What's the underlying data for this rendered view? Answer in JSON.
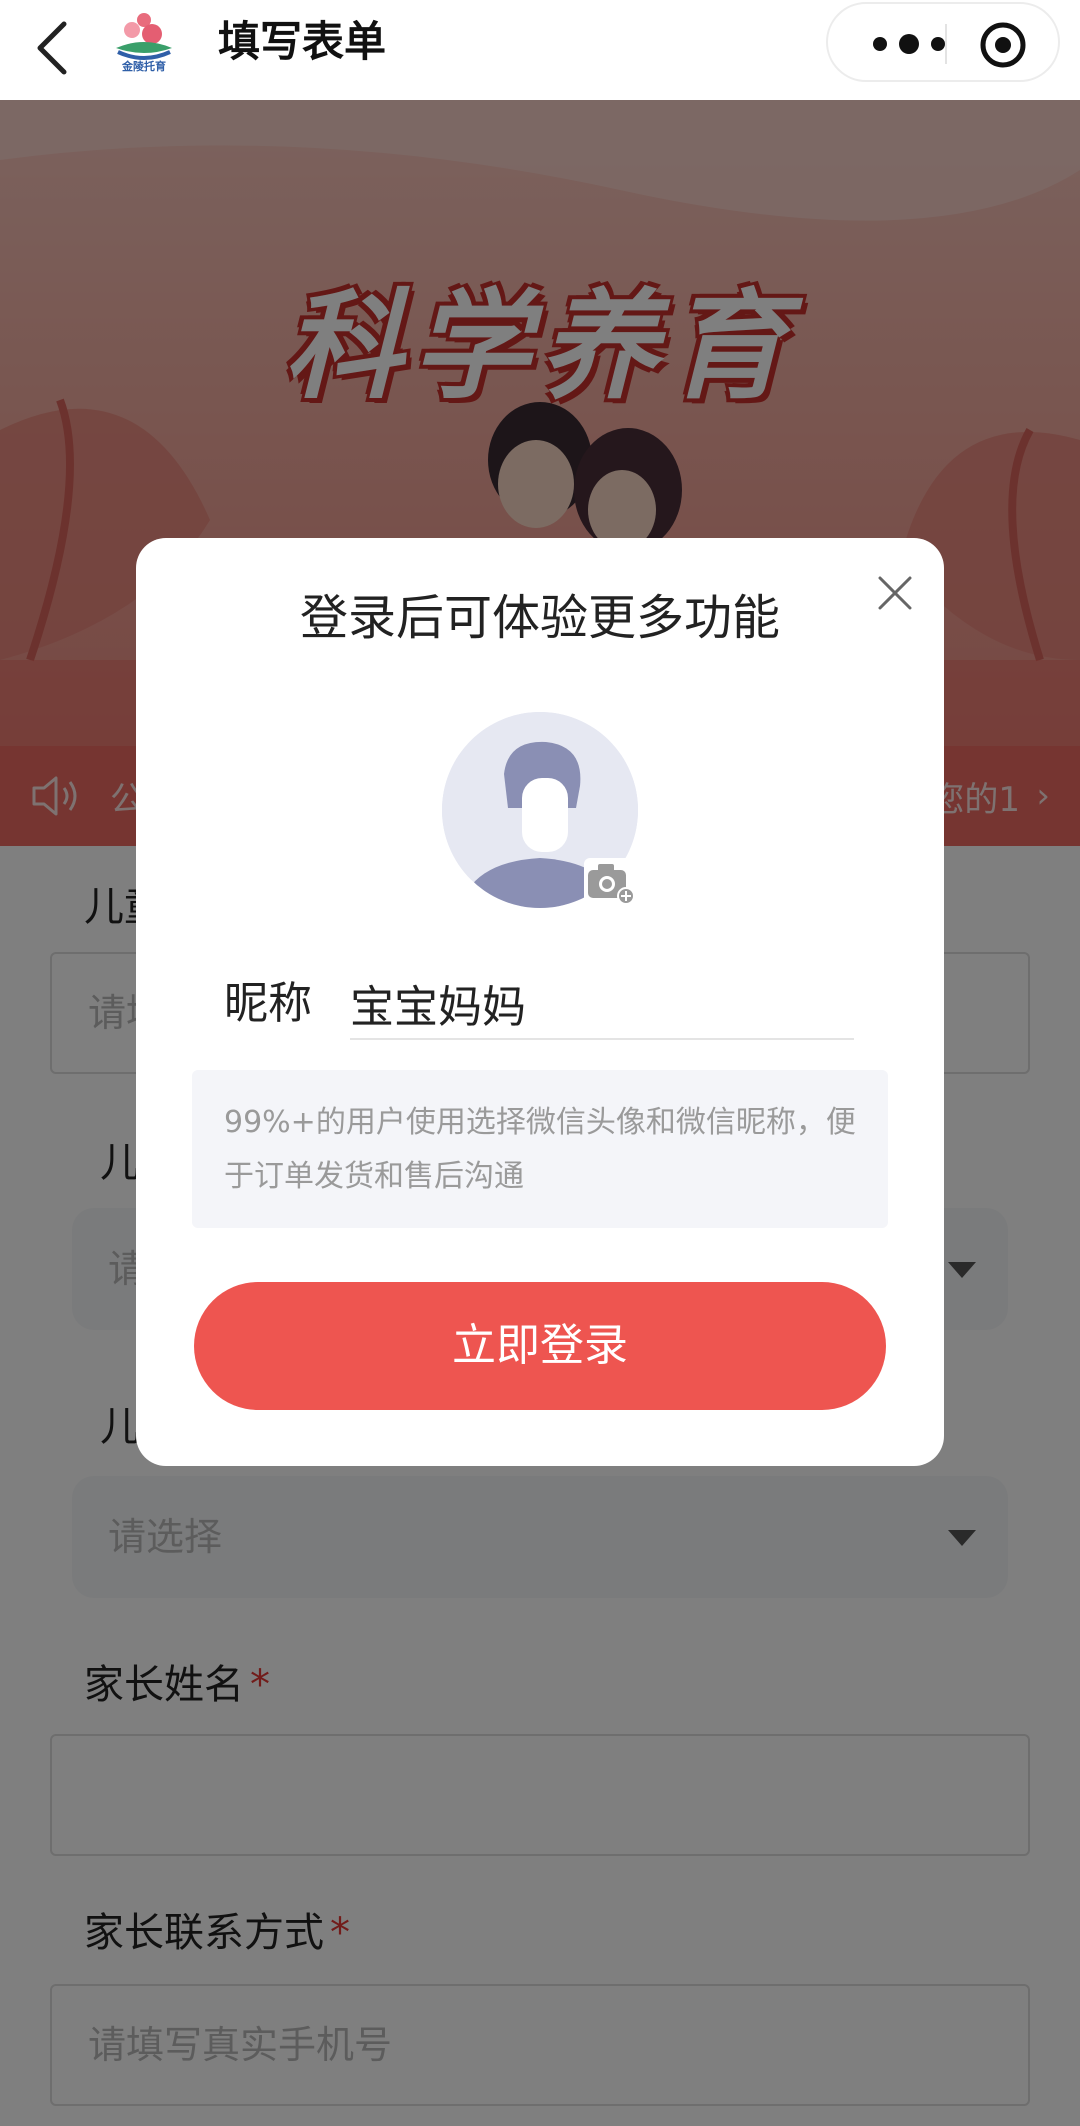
{
  "navbar": {
    "title": "填写表单",
    "logo_text": "金陵托育",
    "back_icon": "chevron-left-icon",
    "more_icon": "more-dots-icon",
    "close_icon": "target-circle-icon"
  },
  "banner": {
    "title": "科学养育"
  },
  "notice": {
    "text": "公",
    "tail_text": "您的1",
    "arrow": "›",
    "icon": "speaker-icon"
  },
  "form": {
    "child_name_label": "儿童",
    "child_name_placeholder": "请填",
    "field2_label": "儿",
    "field2_placeholder": "请",
    "field3_label": "儿",
    "field3_placeholder": "请选择",
    "parent_name_label": "家长姓名",
    "parent_name_required": "*",
    "parent_name_placeholder": "",
    "parent_phone_label": "家长联系方式",
    "parent_phone_required": "*",
    "parent_phone_placeholder": "请填写真实手机号"
  },
  "modal": {
    "title": "登录后可体验更多功能",
    "nickname_label": "昵称",
    "nickname_value": "宝宝妈妈",
    "tip": "99%+的用户使用选择微信头像和微信昵称，便于订单发货和售后沟通",
    "login_button": "立即登录"
  },
  "colors": {
    "accent": "#ee5550",
    "notice_bg": "#ec6a62",
    "required": "#e53935"
  }
}
